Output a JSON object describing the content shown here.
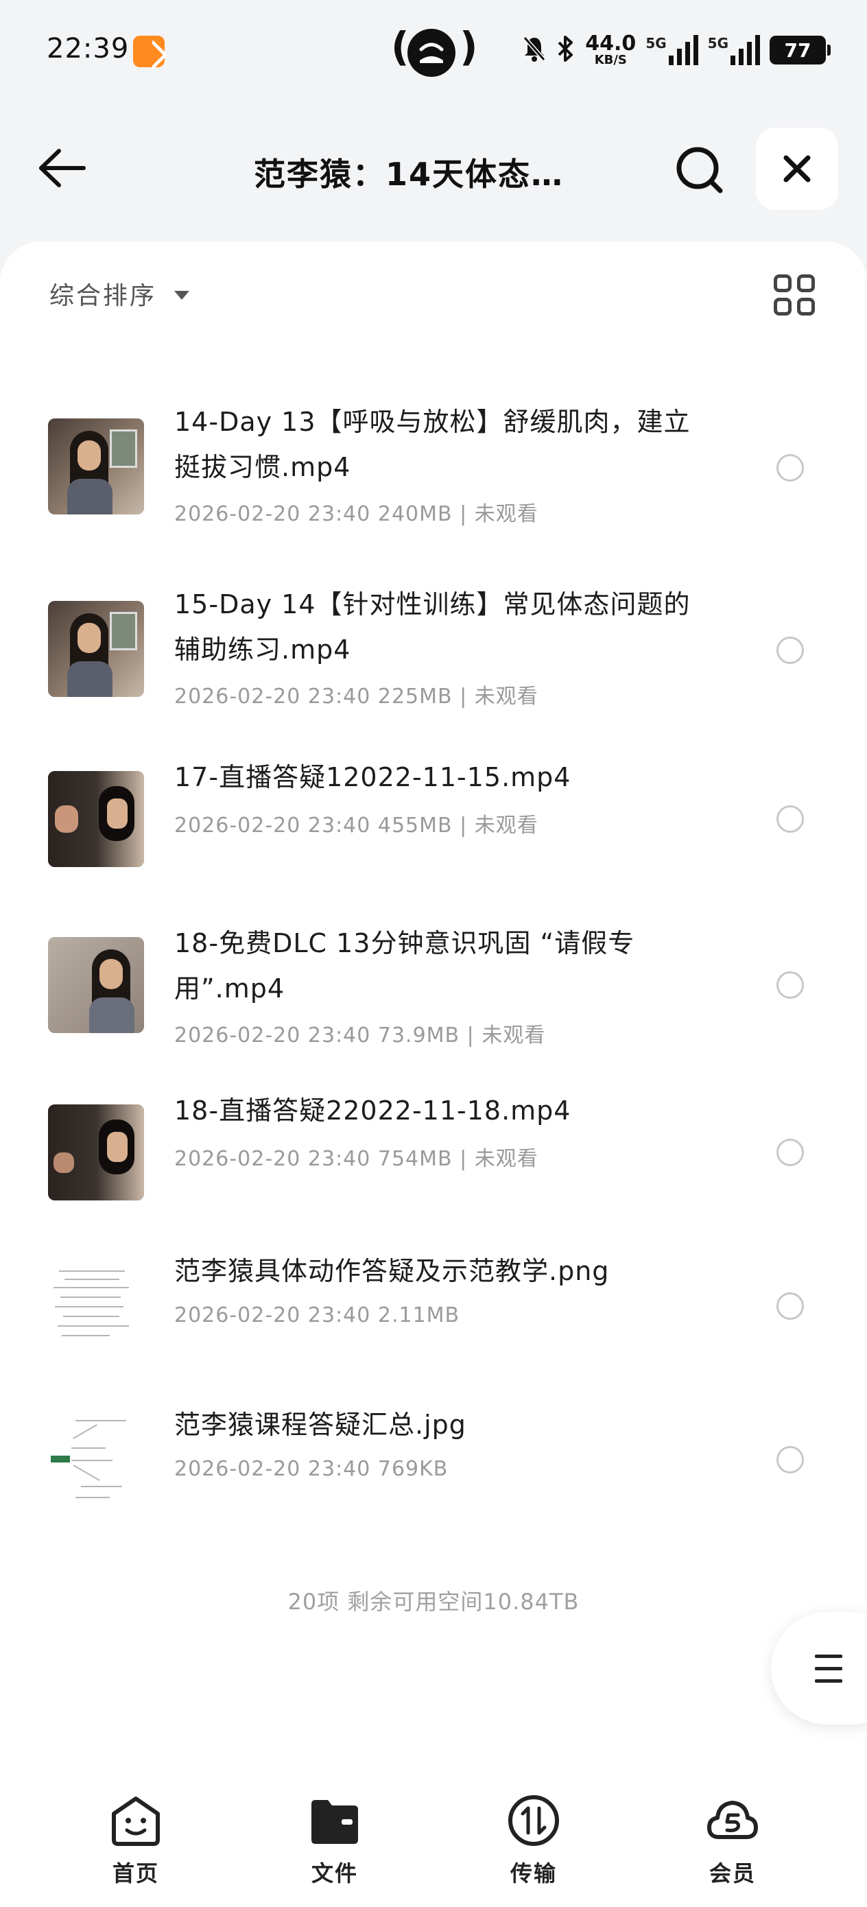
{
  "status_bar": {
    "time": "22:39",
    "net_speed_value": "44.0",
    "net_speed_unit": "KB/S",
    "sim1_label": "5G",
    "sim2_label": "5G",
    "battery": "77",
    "icons": [
      "app-notification-icon",
      "hotspot-icon",
      "mute-icon",
      "bluetooth-icon"
    ]
  },
  "header": {
    "title": "范李猿：14天体态…",
    "back_icon": "arrow-left-icon",
    "search_icon": "search-icon",
    "close_icon": "close-icon"
  },
  "toolbar": {
    "sort_label": "综合排序",
    "view_icon": "grid-view-icon"
  },
  "files": [
    {
      "name": "14-Day 13【呼吸与放松】舒缓肌肉，建立挺拔习惯.mp4",
      "meta": "2026-02-20 23:40  240MB | 未观看",
      "type": "video"
    },
    {
      "name": "15-Day 14【针对性训练】常见体态问题的辅助练习.mp4",
      "meta": "2026-02-20 23:40  225MB | 未观看",
      "type": "video"
    },
    {
      "name": "17-直播答疑12022-11-15.mp4",
      "meta": "2026-02-20 23:40  455MB | 未观看",
      "type": "video"
    },
    {
      "name": "18-免费DLC 13分钟意识巩固 “请假专用”.mp4",
      "meta": "2026-02-20 23:40  73.9MB | 未观看",
      "type": "video"
    },
    {
      "name": "18-直播答疑22022-11-18.mp4",
      "meta": "2026-02-20 23:40  754MB | 未观看",
      "type": "video"
    },
    {
      "name": "范李猿具体动作答疑及示范教学.png",
      "meta": "2026-02-20 23:40  2.11MB",
      "type": "image"
    },
    {
      "name": "范李猿课程答疑汇总.jpg",
      "meta": "2026-02-20 23:40  769KB",
      "type": "image"
    }
  ],
  "summary": "20项 剩余可用空间10.84TB",
  "tabs": [
    {
      "label": "首页",
      "icon": "home-face-icon"
    },
    {
      "label": "文件",
      "icon": "folder-icon"
    },
    {
      "label": "传输",
      "icon": "transfer-icon"
    },
    {
      "label": "会员",
      "icon": "vip-cloud-icon"
    }
  ]
}
